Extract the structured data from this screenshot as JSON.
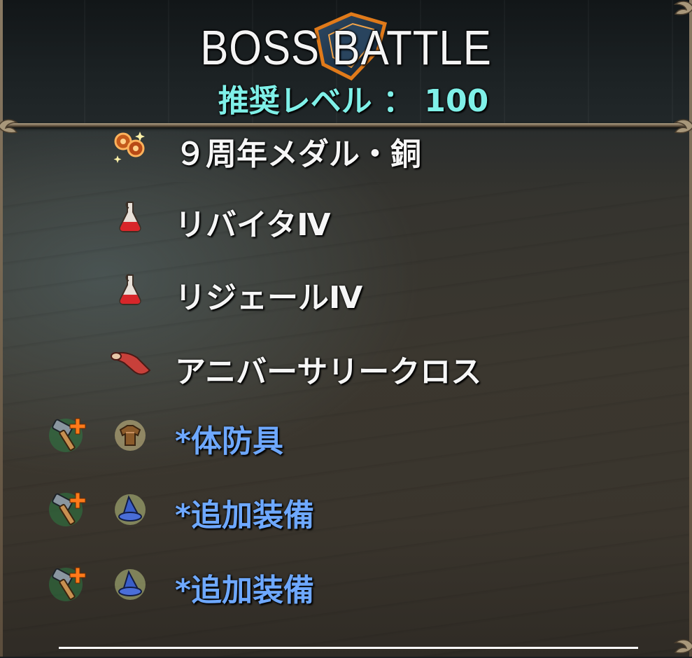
{
  "header": {
    "title": "BOSS BATTLE",
    "recommended_level": "推奨レベル ： 100"
  },
  "rewards": [
    {
      "name": "９周年メダル・銅",
      "icon": "bronze-medals-icon",
      "color": "white",
      "upgrade": false
    },
    {
      "name": "リバイタⅣ",
      "icon": "potion-flask-icon",
      "color": "white",
      "upgrade": false
    },
    {
      "name": "リジェールⅣ",
      "icon": "potion-flask-icon",
      "color": "white",
      "upgrade": false
    },
    {
      "name": "アニバーサリークロス",
      "icon": "cloth-roll-icon",
      "color": "white",
      "upgrade": false
    },
    {
      "name": "*体防具",
      "icon": "body-armor-icon",
      "color": "blue",
      "upgrade": true
    },
    {
      "name": "*追加装備",
      "icon": "wizard-hat-icon",
      "color": "blue",
      "upgrade": true
    },
    {
      "name": "*追加装備",
      "icon": "wizard-hat-icon",
      "color": "blue",
      "upgrade": true
    }
  ],
  "colors": {
    "title": "#f4f4f4",
    "recommended_level": "#7ff0e8",
    "item_normal": "#f6f6f6",
    "item_equipment": "#6ea8ff"
  }
}
